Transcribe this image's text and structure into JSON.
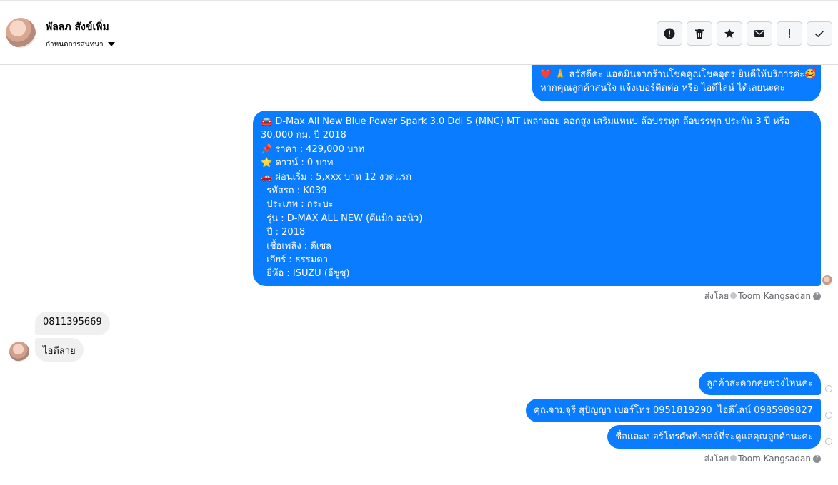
{
  "header": {
    "name": "พัลลภ สังข์เพิ่ม",
    "subtitle": "กำหนดการสนทนา",
    "actions": [
      "alert-circle-icon",
      "trash-icon",
      "star-icon",
      "envelope-icon",
      "exclamation-icon",
      "check-icon"
    ]
  },
  "messages": {
    "greeting": {
      "line1": "❤️ 🙏 สวัสดีค่ะ แอดมินจากร้านโชคคูณโชคอุดร ยินดีให้บริการค่ะ🥰",
      "line2": "หากคุณลูกค้าสนใจ แจ้งเบอร์ติดต่อ หรือ ไอดีไลน์ ได้เลยนะคะ"
    },
    "listing": {
      "l1": "🚘 D-Max All New Blue Power Spark 3.0 Ddi S (MNC) MT เพลาลอย คอกสูง เสริมแหนบ ล้อบรรทุก ล้อบรรทุก ประกัน 3 ปี หรือ",
      "l2": "30,000 กม. ปี 2018",
      "l3": "📌 ราคา : 429,000 บาท",
      "l4": "⭐ ดาวน์ : 0 บาท",
      "l5": "🚗 ผ่อนเริ่ม : 5,xxx บาท 12 งวดแรก",
      "l6": "  รหัสรถ : K039",
      "l7": "  ประเภท : กระบะ",
      "l8": "  รุ่น : D-MAX ALL NEW (ดีแม็ก ออนิว)",
      "l9": "  ปี : 2018",
      "l10": "  เชื้อเพลิง : ดีเซล",
      "l11": "  เกียร์ : ธรรมดา",
      "l12": "  ยี่ห้อ : ISUZU (อีซูซุ)"
    },
    "sent_by_prefix": "ส่งโดย",
    "sent_by_name": "Toom Kangsadan",
    "customer_phone": "0811395669",
    "customer_id": "ไอดีลาย",
    "reply1": "ลูกค้าสะดวกคุยช่วงไหนค่ะ",
    "reply2": "คุณจามจุรี สุปัญญา เบอร์โทร 0951819290  ไอดีไลน์ 0985989827",
    "reply3": "ชื่อและเบอร์โทรศัพท์เซลล์ที่จะดูแลคุณลูกค้านะคะ",
    "help_mark": "?"
  },
  "colors": {
    "outgoing": "#0a7cff",
    "incoming": "#f0f0f0",
    "meta": "#65676b"
  }
}
